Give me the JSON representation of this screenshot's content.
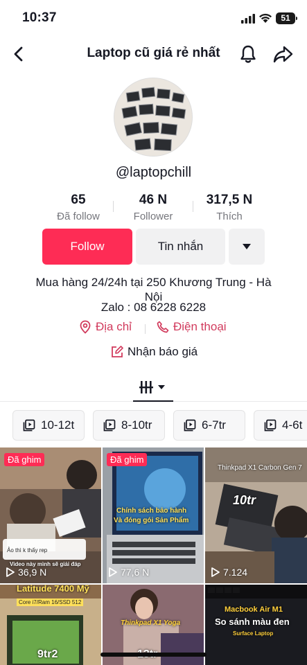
{
  "status": {
    "time": "10:37",
    "battery": "51"
  },
  "header": {
    "title": "Laptop cũ giá rẻ nhất"
  },
  "profile": {
    "username": "@laptopchill",
    "stats": [
      {
        "value": "65",
        "label": "Đã follow"
      },
      {
        "value": "46 N",
        "label": "Follower"
      },
      {
        "value": "317,5 N",
        "label": "Thích"
      }
    ],
    "follow_label": "Follow",
    "message_label": "Tin nhắn",
    "bio_line1": "Mua hàng 24/24h tại 250 Khương Trung - Hà Nội",
    "bio_line2": "Zalo : 08 6228 6228",
    "address_label": "Địa chỉ",
    "phone_label": "Điện thoại",
    "quote_label": "Nhận báo giá"
  },
  "playlists": [
    "10-12t",
    "8-10tr",
    "6-7tr",
    "4-6t"
  ],
  "videos": [
    {
      "pinned": "Đã ghim",
      "views": "36,9 N",
      "captions": [
        "Ảo thì k thấy rep",
        "Video này mình sẽ giải đáp"
      ]
    },
    {
      "pinned": "Đã ghim",
      "views": "77,6 N",
      "captions": [
        "Chính sách bảo hành",
        "Và đóng gói Sản Phẩm"
      ]
    },
    {
      "views": "7.124",
      "captions": [
        "Thinkpad X1 Carbon Gen 7",
        "10tr"
      ]
    },
    {
      "captions": [
        "Latitude 7400 Mỹ",
        "Core i7/Ram 16/SSD 512",
        "9tr2"
      ]
    },
    {
      "captions": [
        "Thinkpad X1 Yoga",
        "13tr"
      ]
    },
    {
      "captions": [
        "Macbook Air M1",
        "So sánh màu đen",
        "Surface Laptop"
      ]
    }
  ],
  "colors": {
    "accent": "#fe2c55",
    "link": "#d13a5c",
    "muted": "#75767c"
  }
}
